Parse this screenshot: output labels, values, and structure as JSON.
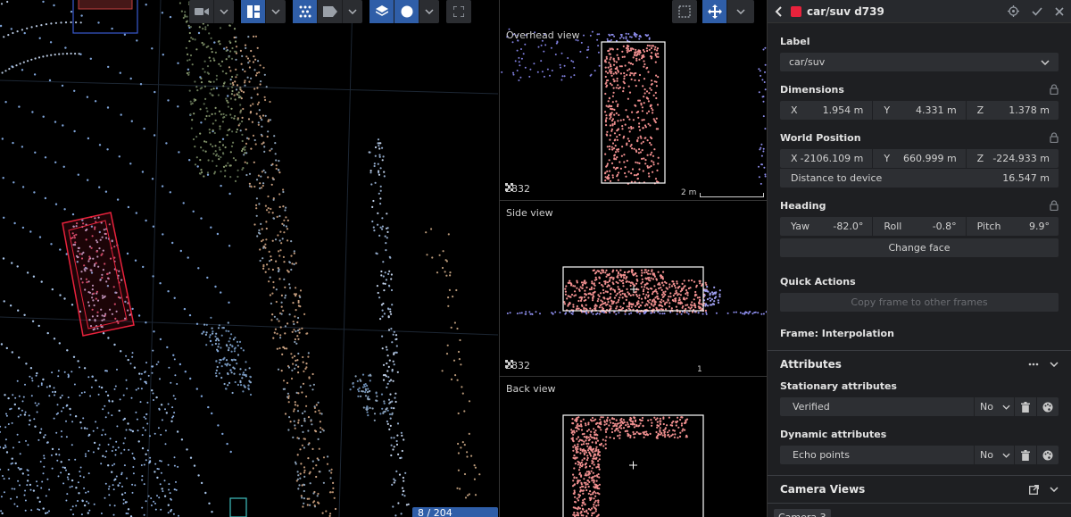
{
  "main_view": {
    "toolbar": {
      "camera_icon": "video-camera-icon",
      "layout_icon": "grid-layout-icon",
      "points_icon": "point-cloud-icon",
      "label_icon": "tag-icon",
      "layers_icon": "layers-icon",
      "dot_icon": "circle-icon",
      "fullscreen_icon": "fullscreen-icon"
    },
    "check_badge": "8 / 204 checked",
    "colors": {
      "active": "#2f5ea8",
      "box": "#e8223c"
    }
  },
  "ortho": {
    "toolbar": {
      "select_icon": "box-select-icon",
      "move_icon": "move-arrows-icon"
    },
    "views": [
      {
        "label": "Overhead view",
        "frame": "2832",
        "scale": "2 m"
      },
      {
        "label": "Side view",
        "frame": "2832",
        "scale": "1 m"
      },
      {
        "label": "Back view"
      }
    ]
  },
  "panel": {
    "header": {
      "title": "car/suv d739",
      "color": "#e8223c"
    },
    "label": {
      "title": "Label",
      "value": "car/suv"
    },
    "dimensions": {
      "title": "Dimensions",
      "x_label": "X",
      "x": "1.954 m",
      "y_label": "Y",
      "y": "4.331 m",
      "z_label": "Z",
      "z": "1.378 m"
    },
    "world_position": {
      "title": "World Position",
      "x_label": "X",
      "x": "-2106.109 m",
      "y_label": "Y",
      "y": "660.999 m",
      "z_label": "Z",
      "z": "-224.933 m",
      "distance_label": "Distance to device",
      "distance": "16.547 m"
    },
    "heading": {
      "title": "Heading",
      "yaw_label": "Yaw",
      "yaw": "-82.0°",
      "roll_label": "Roll",
      "roll": "-0.8°",
      "pitch_label": "Pitch",
      "pitch": "9.9°",
      "change_face": "Change face"
    },
    "quick_actions": {
      "title": "Quick Actions",
      "copy": "Copy frame to other frames"
    },
    "frame": "Frame: Interpolation",
    "attributes": {
      "title": "Attributes",
      "stationary_title": "Stationary attributes",
      "stationary": [
        {
          "name": "Verified",
          "value": "No"
        }
      ],
      "dynamic_title": "Dynamic attributes",
      "dynamic": [
        {
          "name": "Echo points",
          "value": "No"
        }
      ]
    },
    "camera_views": {
      "title": "Camera Views",
      "chip": "Camera 3"
    }
  }
}
